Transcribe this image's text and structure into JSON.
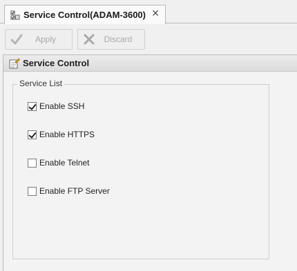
{
  "tab": {
    "title": "Service Control(ADAM-3600)",
    "icon": "service-control-icon",
    "close_glyph": "✕"
  },
  "toolbar": {
    "apply_label": "Apply",
    "discard_label": "Discard",
    "apply_enabled": false,
    "discard_enabled": false
  },
  "panel": {
    "title": "Service Control",
    "icon": "edit-list-icon"
  },
  "service_list": {
    "legend": "Service List",
    "options": [
      {
        "label": "Enable SSH",
        "checked": true
      },
      {
        "label": "Enable HTTPS",
        "checked": true
      },
      {
        "label": "Enable Telnet",
        "checked": false
      },
      {
        "label": "Enable FTP Server",
        "checked": false
      }
    ]
  },
  "colors": {
    "background": "#f0f0f0",
    "disabled_text": "#a8a8a8",
    "border": "#b9b9b9"
  }
}
